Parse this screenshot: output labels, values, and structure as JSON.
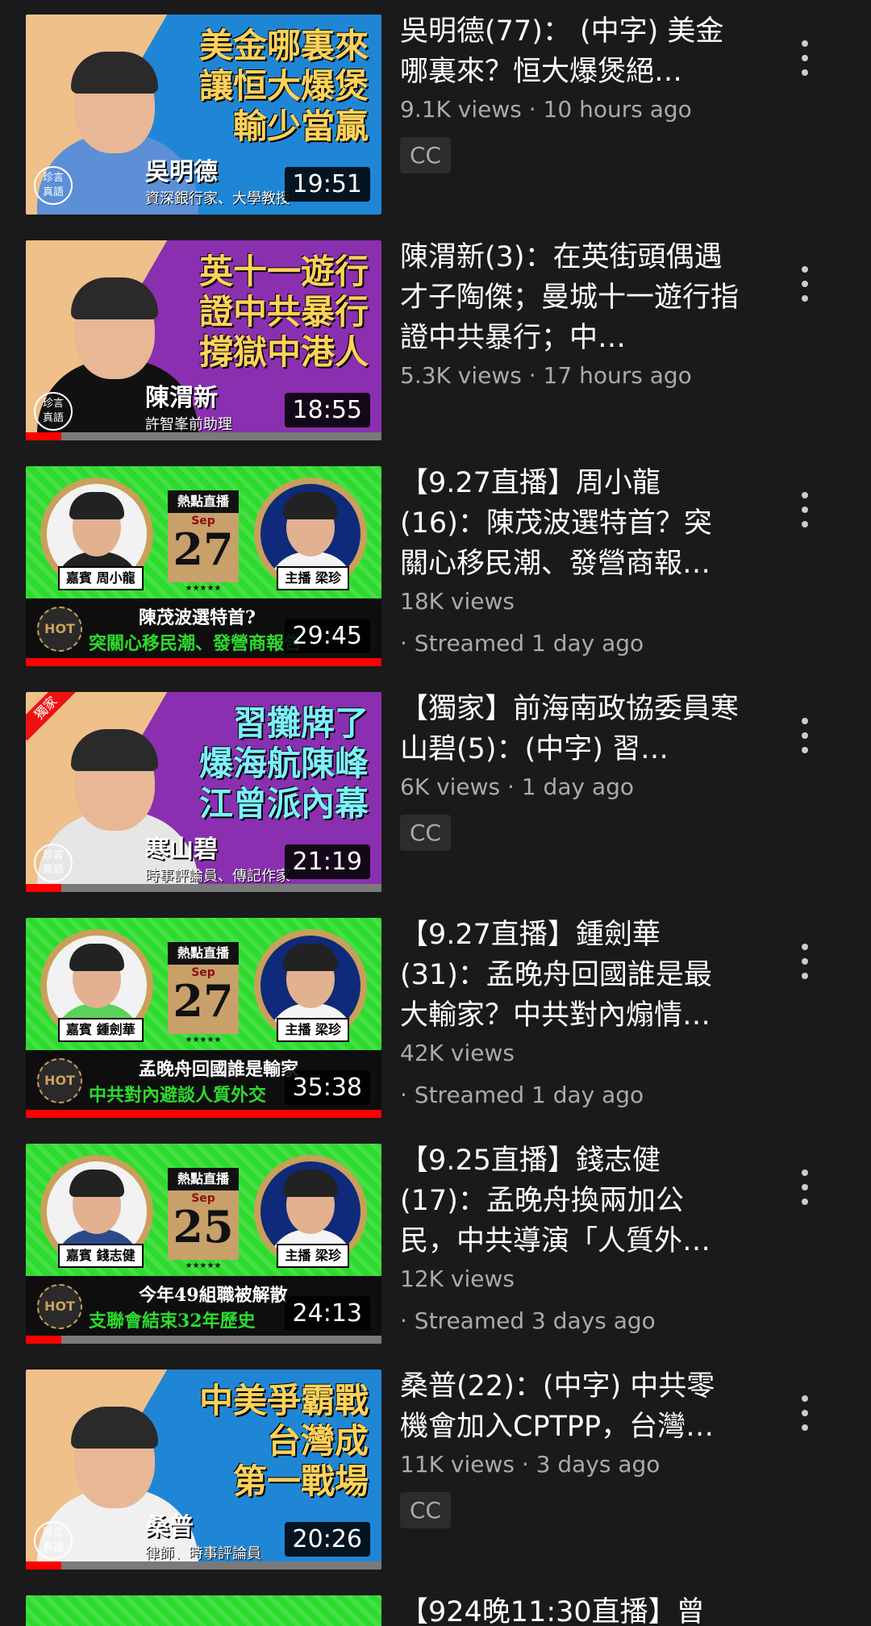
{
  "videos": [
    {
      "type": "talk",
      "headline": "美金哪裏來\n讓恒大爆煲\n輸少當贏",
      "name": "吳明德",
      "role": "資深銀行家、大學教授",
      "logo": "珍言\n真語",
      "duration": "19:51",
      "title": "吳明德(77)： (中字) 美金哪裏來？恒大爆煲絕…",
      "meta": "9.1K views · 10 hours ago",
      "cc": "CC",
      "bg": "#1f86d6",
      "headline_color": "#ffd25a",
      "shirt": "#5d8fd6",
      "progress": 0
    },
    {
      "type": "talk",
      "headline": "英十一遊行\n證中共暴行\n撐獄中港人",
      "name": "陳渭新",
      "role": "許智峯前助理",
      "logo": "珍言\n真語",
      "duration": "18:55",
      "title": "陳渭新(3)：在英街頭偶遇才子陶傑；曼城十一遊行指證中共暴行；中…",
      "meta": "5.3K views · 17 hours ago",
      "cc": "",
      "bg": "#8a2fb0",
      "headline_color": "#ffd25a",
      "shirt": "#111111",
      "progress": 0.1
    },
    {
      "type": "live",
      "guest": "周小龍",
      "host": "梁珍",
      "guest_tag": "嘉賓 周小龍",
      "host_tag": "主播 梁珍",
      "cal_head": "熱點直播",
      "cal_month": "Sep",
      "cal_day": "27",
      "stars": "★★★★★",
      "hot": "HOT",
      "b1": "陳茂波選特首?",
      "b2": "突關心移民潮、發營商報告",
      "duration": "29:45",
      "title": "【9.27直播】周小龍(16)：陳茂波選特首？突關心移民潮、發營商報…",
      "meta": "18K views",
      "meta2": "· Streamed 1 day ago",
      "guest_shirt": "#222222",
      "progress": 1.0
    },
    {
      "type": "talk",
      "headline": "習攤牌了\n爆海航陳峰\n江曾派內幕",
      "name": "寒山碧",
      "role": "時事評論員、傳記作家",
      "logo": "珍言\n真語",
      "duration": "21:19",
      "title": "【獨家】前海南政協委員寒山碧(5)：(中字) 習…",
      "meta": "6K views · 1 day ago",
      "cc": "CC",
      "bg": "#8a2fb0",
      "headline_color": "#7df0ff",
      "shirt": "#e6e6e6",
      "badge": "獨家",
      "progress": 0.1
    },
    {
      "type": "live",
      "guest": "鍾劍華",
      "host": "梁珍",
      "guest_tag": "嘉賓 鍾劍華",
      "host_tag": "主播 梁珍",
      "cal_head": "熱點直播",
      "cal_month": "Sep",
      "cal_day": "27",
      "stars": "★★★★★",
      "hot": "HOT",
      "b1": "孟晚舟回國誰是輸家",
      "b2": "中共對內避談人質外交",
      "duration": "35:38",
      "title": "【9.27直播】鍾劍華(31)：孟晚舟回國誰是最大輸家？中共對內煽情…",
      "meta": "42K views",
      "meta2": "· Streamed 1 day ago",
      "guest_shirt": "#5bd15b",
      "progress": 1.0
    },
    {
      "type": "live",
      "guest": "錢志健",
      "host": "梁珍",
      "guest_tag": "嘉賓 錢志健",
      "host_tag": "主播 梁珍",
      "cal_head": "熱點直播",
      "cal_month": "Sep",
      "cal_day": "25",
      "stars": "★★★★★",
      "hot": "HOT",
      "b1": "今年49組職被解散",
      "b2": "支聯會結束32年歷史",
      "duration": "24:13",
      "title": "【9.25直播】錢志健(17)：孟晚舟換兩加公民，中共導演「人質外…",
      "meta": "12K views",
      "meta2": "· Streamed 3 days ago",
      "guest_shirt": "#2a4a8a",
      "progress": 0.1
    },
    {
      "type": "talk",
      "headline": "中美爭霸戰\n台灣成\n第一戰場",
      "name": "桑普",
      "role": "律師、時事評論員",
      "logo": "珍言\n真語",
      "duration": "20:26",
      "title": "桑普(22)：(中字) 中共零機會加入CPTPP，台灣…",
      "meta": "11K views · 3 days ago",
      "cc": "CC",
      "bg": "#1f86d6",
      "headline_color": "#ffd25a",
      "shirt": "#f0f0f0",
      "progress": 0.1
    }
  ],
  "partial_title": "【924晚11:30直播】曾"
}
